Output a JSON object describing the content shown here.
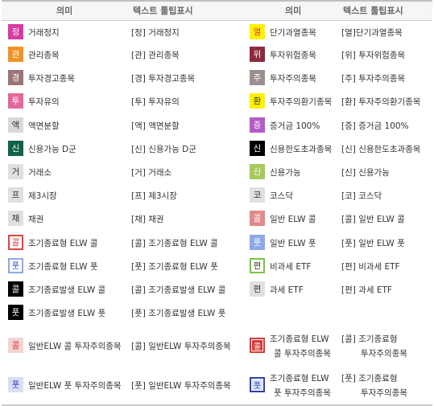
{
  "header": {
    "col1": "의미",
    "col2": "텍스트 툴팁표시",
    "col3": "의미",
    "col4": "텍스트 툴팁표시"
  },
  "left": [
    {
      "badge": "정",
      "bg": "#d83ba0",
      "fg": "#ffffff",
      "name": "거래정지",
      "tip": "[정] 거래정지"
    },
    {
      "badge": "관",
      "bg": "#f39325",
      "fg": "#ffffff",
      "name": "관리종목",
      "tip": "[관] 관리종목"
    },
    {
      "badge": "경",
      "bg": "#9b7476",
      "fg": "#ffffff",
      "name": "투자경고종목",
      "tip": "[경] 투자경고종목"
    },
    {
      "badge": "투",
      "bg": "#e4689b",
      "fg": "#ffffff",
      "name": "투자유의",
      "tip": "[투] 투자유의"
    },
    {
      "badge": "액",
      "bg": "#d9d9d9",
      "fg": "#333333",
      "name": "액면분할",
      "tip": "[액] 액면분할"
    },
    {
      "badge": "신",
      "bg": "#11624a",
      "fg": "#ffffff",
      "name": "신용가능 D군",
      "tip": "[신] 신용가능 D군"
    },
    {
      "badge": "거",
      "bg": "#e0e0e0",
      "fg": "#333333",
      "name": "거래소",
      "tip": "[거] 거래소"
    },
    {
      "badge": "프",
      "bg": "#e0e0e0",
      "fg": "#333333",
      "name": "제3시장",
      "tip": "[프] 제3시장"
    },
    {
      "badge": "채",
      "bg": "#e0e0e0",
      "fg": "#333333",
      "name": "채권",
      "tip": "[채] 채권"
    },
    {
      "badge": "콜",
      "bg": "#ffffff",
      "fg": "#d83b3b",
      "border": "#e34444",
      "name": "조기종료형 ELW 콜",
      "tip": "[콜] 조기종료형 ELW 콜"
    },
    {
      "badge": "풋",
      "bg": "#ffffff",
      "fg": "#3a4fc9",
      "border": "#8fa8e8",
      "name": "조기종료형 ELW 풋",
      "tip": "[풋] 조기종료형 ELW 풋"
    },
    {
      "badge": "콜",
      "bg": "#000000",
      "fg": "#ffffff",
      "name": "조기종료발생 ELW 콜",
      "tip": "[콜] 조기종료발생 ELW 콜"
    },
    {
      "badge": "풋",
      "bg": "#000000",
      "fg": "#ffffff",
      "name": "조기종료발생 ELW 풋",
      "tip": "[풋] 조기종료발생 ELW 풋"
    },
    {
      "badge": "콜",
      "bg": "#f4d3d3",
      "fg": "#d83b3b",
      "name": "일반ELW 콜 투자주의종목",
      "tip": "[콜] 일반ELW 투자주의종목"
    },
    {
      "badge": "풋",
      "bg": "#d9def7",
      "fg": "#2a3fb9",
      "name": "일반ELW 풋 투자주의종목",
      "tip": "[풋] 일반ELW 투자주의종목"
    }
  ],
  "right": [
    {
      "badge": "열",
      "bg": "#fff200",
      "fg": "#d83b3b",
      "name": "단기과열종목",
      "tip": "[열]단기과열종목"
    },
    {
      "badge": "위",
      "bg": "#8c2b3c",
      "fg": "#ffffff",
      "name": "투자위험종목",
      "tip": "[위] 투자위험종목"
    },
    {
      "badge": "주",
      "bg": "#9e8f8f",
      "fg": "#ffffff",
      "name": "투자주의종목",
      "tip": "[주] 투자주의종목"
    },
    {
      "badge": "환",
      "bg": "#fff200",
      "fg": "#333333",
      "name": "투자주의환기종목",
      "tip": "[환] 투자주의환기종목"
    },
    {
      "badge": "증",
      "bg": "#b55bc9",
      "fg": "#ffffff",
      "name": "증거금 100%",
      "tip": "[증] 증거금 100%"
    },
    {
      "badge": "신",
      "bg": "#000000",
      "fg": "#ffffff",
      "name": "신용한도초과종목",
      "tip": "[신] 신용한도초과종목"
    },
    {
      "badge": "신",
      "bg": "#a9c95a",
      "fg": "#ffffff",
      "name": "신용가능",
      "tip": "[신] 신용가능"
    },
    {
      "badge": "코",
      "bg": "#e0e0e0",
      "fg": "#333333",
      "name": "코스닥",
      "tip": "[코] 코스닥"
    },
    {
      "badge": "콜",
      "bg": "#e08a8a",
      "fg": "#ffffff",
      "name": "일반 ELW 콜",
      "tip": "[콜] 일반 ELW 콜"
    },
    {
      "badge": "풋",
      "bg": "#8fa8e8",
      "fg": "#ffffff",
      "name": "일반 ELW 풋",
      "tip": "[풋] 일반 ELW 풋"
    },
    {
      "badge": "편",
      "bg": "#ffffff",
      "fg": "#333333",
      "border": "#7ac143",
      "name": "비과세 ETF",
      "tip": "[편] 비과세 ETF"
    },
    {
      "badge": "편",
      "bg": "#e0e0e0",
      "fg": "#333333",
      "name": "과세 ETF",
      "tip": "[편] 과세 ETF"
    },
    {
      "badge": "콜",
      "bg": "#d83b3b",
      "fg": "#ffffff",
      "border": "#d83b3b",
      "inner": true,
      "name1": "조기종료형 ELW",
      "name2": "콜 투자주의종목",
      "tip1": "[콜] 조기종료형",
      "tip2": "투자주의종목"
    },
    {
      "badge": "풋",
      "bg": "#d9def7",
      "fg": "#2a3fb9",
      "border": "#2a3fb9",
      "inner": true,
      "name1": "조기종료형 ELW",
      "name2": "풋 투자주의종목",
      "tip1": "[풋] 조기종료형",
      "tip2": "투자주의종목"
    }
  ]
}
